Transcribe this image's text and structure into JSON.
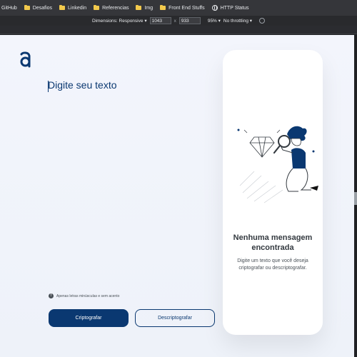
{
  "bookmarks": {
    "items": [
      {
        "label": "GitHub",
        "icon": "bookmark-folder-icon"
      },
      {
        "label": "Desafios",
        "icon": "bookmark-folder-icon"
      },
      {
        "label": "Linkedin",
        "icon": "bookmark-folder-icon"
      },
      {
        "label": "Referencias",
        "icon": "bookmark-folder-icon"
      },
      {
        "label": "Img",
        "icon": "bookmark-folder-icon"
      },
      {
        "label": "Front End Stuffs",
        "icon": "bookmark-folder-icon"
      },
      {
        "label": "HTTP Status",
        "icon": "globe-icon"
      }
    ]
  },
  "devtools": {
    "dimensions_label": "Dimensions: Responsive",
    "width_value": "1043",
    "height_value": "933",
    "separator": "x",
    "zoom": "95%",
    "throttling": "No throttling"
  },
  "app": {
    "brand_color": "#0a3871",
    "logo_letter": "a",
    "input_placeholder": "Digite seu texto",
    "hint_text": "Apenas letras minúsculas e sem acento",
    "hint_icon": "info-icon",
    "encrypt_button": "Criptografar",
    "decrypt_button": "Descriptografar",
    "result": {
      "title": "Nenhuma mensagem encontrada",
      "description": "Digite um texto que você deseja criptografar ou descriptografar.",
      "illustration": "person-magnifying-glass-illustration"
    }
  }
}
